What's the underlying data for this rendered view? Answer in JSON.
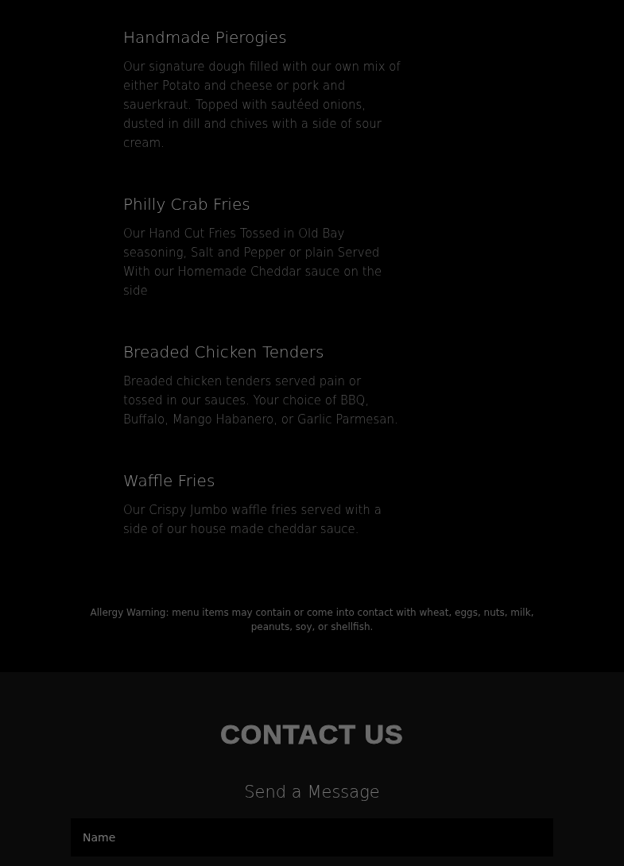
{
  "menu_items": [
    {
      "name": "Handmade Pierogies",
      "description": "Our signature dough filled with our own mix of either Potato and cheese or pork and sauerkraut. Topped with sautéed onions, dusted in dill and chives with a side of sour cream."
    },
    {
      "name": "Philly Crab Fries",
      "description": "Our Hand Cut Fries Tossed in Old Bay seasoning, Salt and Pepper or plain Served  With our Homemade Cheddar sauce on the side"
    },
    {
      "name": "Breaded Chicken Tenders",
      "description": "Breaded chicken tenders served pain or tossed in our sauces. Your choice of BBQ, Buffalo, Mango Habanero, or Garlic Parmesan."
    },
    {
      "name": "Waffle Fries",
      "description": "Our Crispy Jumbo waffle fries served with a side of our house made cheddar sauce."
    }
  ],
  "allergy_warning": "Allergy Warning: menu items may contain or come into contact with wheat, eggs, nuts, milk, peanuts, soy, or shellfish.",
  "contact": {
    "title": "CONTACT US",
    "subtitle": "Send a Message",
    "fields": [
      {
        "placeholder": "Name"
      }
    ]
  }
}
